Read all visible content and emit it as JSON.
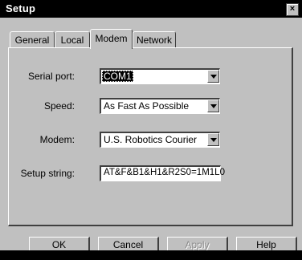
{
  "window": {
    "title": "Setup",
    "close_glyph": "×"
  },
  "tabs": [
    {
      "label": "General",
      "active": false
    },
    {
      "label": "Local",
      "active": false
    },
    {
      "label": "Modem",
      "active": true
    },
    {
      "label": "Network",
      "active": false
    }
  ],
  "form": {
    "serial_port": {
      "label": "Serial port:",
      "value": "COM1"
    },
    "speed": {
      "label": "Speed:",
      "value": "As Fast As Possible"
    },
    "modem": {
      "label": "Modem:",
      "value": "U.S. Robotics Courier"
    },
    "setup_string": {
      "label": "Setup string:",
      "value": "AT&F&B1&H1&R2S0=1M1L0"
    }
  },
  "buttons": {
    "ok": "OK",
    "cancel": "Cancel",
    "apply": "Apply",
    "help": "Help"
  },
  "colors": {
    "face": "#c0c0c0",
    "titlebar": "#000000",
    "highlight": "#ffffff",
    "shadow": "#404040"
  },
  "icons": {
    "close": "close-icon",
    "dropdown": "chevron-down-icon"
  }
}
